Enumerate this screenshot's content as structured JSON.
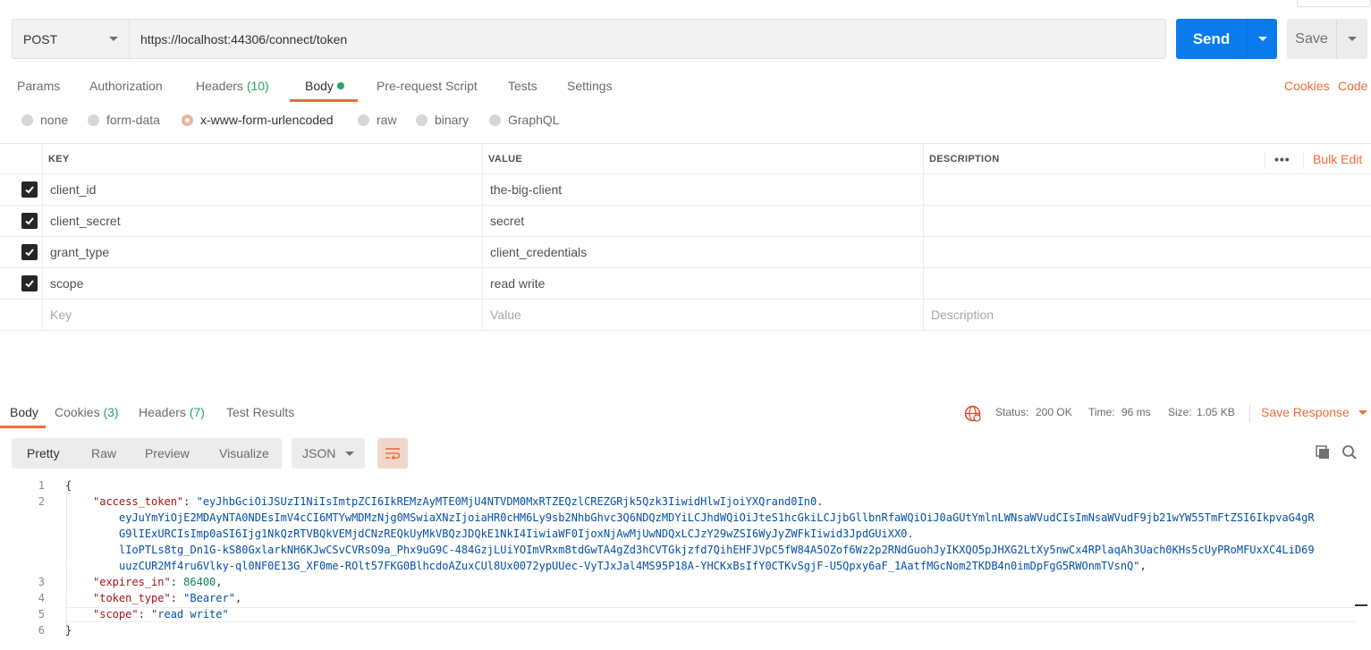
{
  "request": {
    "method": "POST",
    "url": "https://localhost:44306/connect/token",
    "send_label": "Send",
    "save_label": "Save"
  },
  "request_tabs": {
    "params": "Params",
    "authorization": "Authorization",
    "headers": "Headers",
    "headers_count": "(10)",
    "body": "Body",
    "prerequest": "Pre-request Script",
    "tests": "Tests",
    "settings": "Settings",
    "cookies": "Cookies",
    "code": "Code"
  },
  "body_types": {
    "none": "none",
    "form_data": "form-data",
    "urlencoded": "x-www-form-urlencoded",
    "raw": "raw",
    "binary": "binary",
    "graphql": "GraphQL",
    "selected": "x-www-form-urlencoded"
  },
  "params_table": {
    "headers": {
      "key": "KEY",
      "value": "VALUE",
      "description": "DESCRIPTION",
      "bulk_edit": "Bulk Edit",
      "more": "•••"
    },
    "rows": [
      {
        "key": "client_id",
        "value": "the-big-client",
        "checked": true
      },
      {
        "key": "client_secret",
        "value": "secret",
        "checked": true
      },
      {
        "key": "grant_type",
        "value": "client_credentials",
        "checked": true
      },
      {
        "key": "scope",
        "value": "read write",
        "checked": true
      }
    ],
    "placeholders": {
      "key": "Key",
      "value": "Value",
      "description": "Description"
    }
  },
  "response": {
    "tabs": {
      "body": "Body",
      "cookies": "Cookies",
      "cookies_count": "(3)",
      "headers": "Headers",
      "headers_count": "(7)",
      "test_results": "Test Results"
    },
    "status_label": "Status:",
    "status_value": "200 OK",
    "time_label": "Time:",
    "time_value": "96 ms",
    "size_label": "Size:",
    "size_value": "1.05 KB",
    "save_response": "Save Response",
    "views": {
      "pretty": "Pretty",
      "raw": "Raw",
      "preview": "Preview",
      "visualize": "Visualize"
    },
    "format": "JSON",
    "line_numbers": [
      "1",
      "2",
      "3",
      "4",
      "5",
      "6"
    ],
    "code": {
      "open_brace": "{",
      "access_token_key": "\"access_token\"",
      "access_token_lines": [
        "\"eyJhbGciOiJSUzI1NiIsImtpZCI6IkREMzAyMTE0MjU4NTVDM0MxRTZEQzlCREZGRjk5Qzk3IiwidHlwIjoiYXQrand0In0.",
        "eyJuYmYiOjE2MDAyNTA0NDEsImV4cCI6MTYwMDMzNjg0MSwiaXNzIjoiaHR0cHM6Ly9sb2NhbGhvc3Q6NDQzMDYiLCJhdWQiOiJteS1hcGkiLCJjbGllbnRfaWQiOiJ0aGUtYmlnLWNsaWVudCIsImNsaWVudF9jb21wYW55TmFtZSI6IkpvaG4gR",
        "G9lIExURCIsImp0aSI6Ijg1NkQzRTVBQkVEMjdCNzREQkUyMkVBQzJDQkE1NkI4IiwiaWF0IjoxNjAwMjUwNDQxLCJzY29wZSI6WyJyZWFkIiwid3JpdGUiXX0.",
        "lIoPTLs8tg_Dn1G-kS80GxlarkNH6KJwCSvCVRsO9a_Phx9uG9C-484GzjLUiYOImVRxm8tdGwTA4gZd3hCVTGkjzfd7QihEHFJVpC5fW84A5OZof6Wz2p2RNdGuohJyIKXQO5pJHXG2LtXy5nwCx4RPlaqAh3Uach0KHs5cUyPRoMFUxXC4LiD69",
        "uuzCUR2Mf4ru6Vlky-ql0NF0E13G_XF0me-ROlt57FKG0BlhcdoAZuxCUl8Ux0072ypUUec-VyTJxJal4MS95P18A-YHCKxBsIfY0CTKvSgjF-U5Qpxy6aF_1AatfMGcNom2TKDB4n0imDpFgG5RWOnmTVsnQ\""
      ],
      "expires_in_key": "\"expires_in\"",
      "expires_in_value": "86400",
      "token_type_key": "\"token_type\"",
      "token_type_value": "\"Bearer\"",
      "scope_key": "\"scope\"",
      "scope_value": "\"read write\"",
      "close_brace": "}"
    }
  },
  "colors": {
    "accent": "#f26b3a",
    "primary": "#097bed",
    "success": "#26a660"
  }
}
